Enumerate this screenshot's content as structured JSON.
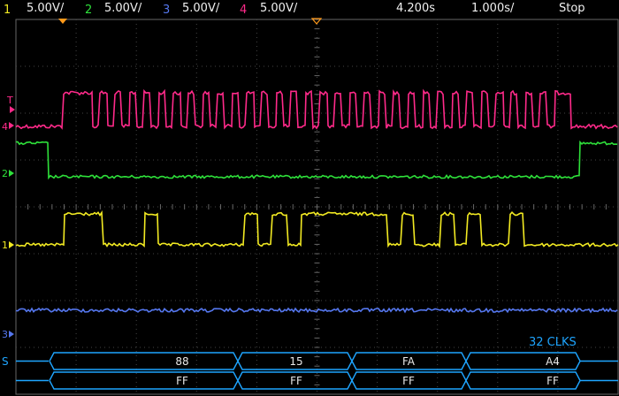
{
  "status": {
    "channels": [
      {
        "num": "1",
        "scale": "5.00V/",
        "color": "#f2ea22"
      },
      {
        "num": "2",
        "scale": "5.00V/",
        "color": "#2ee03a"
      },
      {
        "num": "3",
        "scale": "5.00V/",
        "color": "#5577ee"
      },
      {
        "num": "4",
        "scale": "5.00V/",
        "color": "#ff2a8a"
      }
    ],
    "timebase_pos": "4.200s",
    "timebase_scale": "1.000s/",
    "run_state": "Stop"
  },
  "markers": {
    "ch4": "4",
    "trigger": "T",
    "ch2": "2",
    "ch1": "1",
    "ch3": "3",
    "serial": "S"
  },
  "serial_decode": {
    "clock_count": "32 CLKS",
    "row1": [
      "88",
      "15",
      "FA",
      "A4"
    ],
    "row2": [
      "FF",
      "FF",
      "FF",
      "FF"
    ]
  },
  "colors": {
    "ch1": "#f2ea22",
    "ch2": "#2ee03a",
    "ch3": "#5577ee",
    "ch4": "#ff2a8a",
    "decode": "#1ea5ff",
    "grid": "#555555"
  }
}
